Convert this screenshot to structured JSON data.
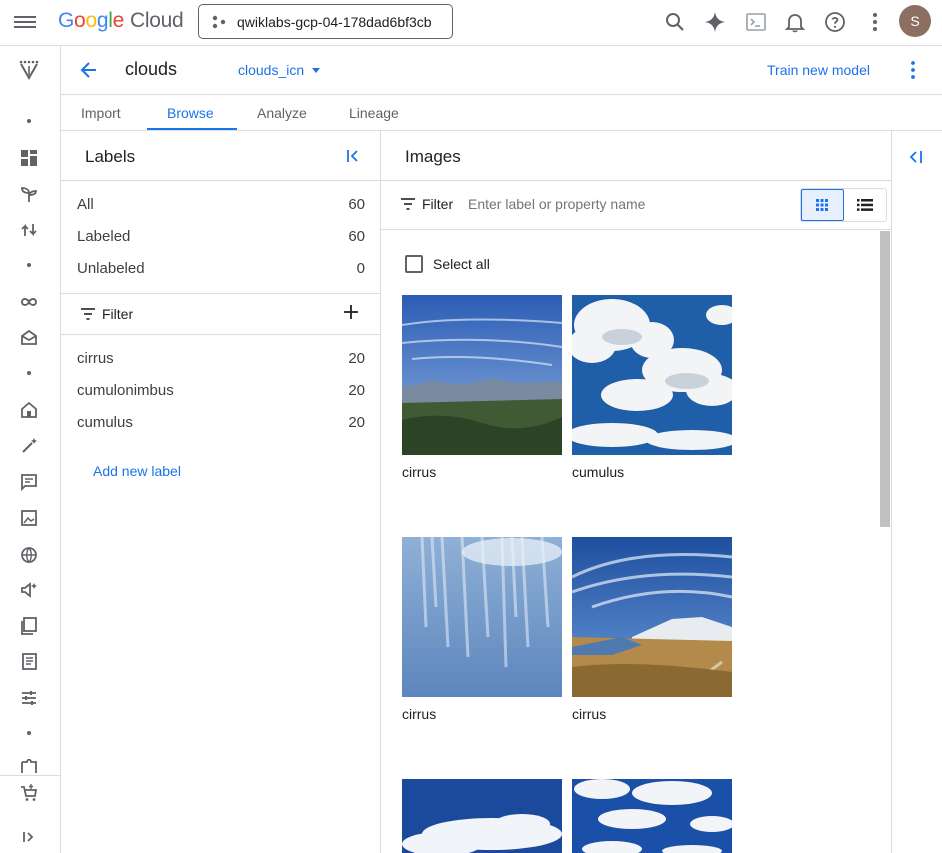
{
  "topbar": {
    "project": "qwiklabs-gcp-04-178dad6bf3cb",
    "avatar_initial": "S",
    "logo": {
      "g1": "G",
      "g2": "o",
      "g3": "o",
      "g4": "g",
      "g5": "l",
      "g6": "e",
      "cloud": "Cloud"
    },
    "icons": [
      "menu-icon",
      "search-icon",
      "gemini-spark-icon",
      "cloud-shell-icon",
      "notifications-icon",
      "help-icon",
      "more-vert-icon"
    ]
  },
  "header": {
    "title": "clouds",
    "dataset_select": "clouds_icn",
    "train_button": "Train new model"
  },
  "tabs": [
    {
      "label": "Import"
    },
    {
      "label": "Browse"
    },
    {
      "label": "Analyze"
    },
    {
      "label": "Lineage"
    }
  ],
  "labels_panel": {
    "title": "Labels",
    "summary": [
      {
        "name": "All",
        "count": "60"
      },
      {
        "name": "Labeled",
        "count": "60"
      },
      {
        "name": "Unlabeled",
        "count": "0"
      }
    ],
    "filter_label": "Filter",
    "labels": [
      {
        "name": "cirrus",
        "count": "20"
      },
      {
        "name": "cumulonimbus",
        "count": "20"
      },
      {
        "name": "cumulus",
        "count": "20"
      }
    ],
    "add_label": "Add new label"
  },
  "images_panel": {
    "title": "Images",
    "filter_label": "Filter",
    "filter_placeholder": "Enter label or property name",
    "select_all": "Select all",
    "images": [
      {
        "caption": "cirrus"
      },
      {
        "caption": "cumulus"
      },
      {
        "caption": "cirrus"
      },
      {
        "caption": "cirrus"
      },
      {
        "caption": ""
      },
      {
        "caption": ""
      }
    ]
  },
  "colors": {
    "accent": "#1a73e8",
    "border": "#dadce0",
    "icon": "#5f6368"
  }
}
